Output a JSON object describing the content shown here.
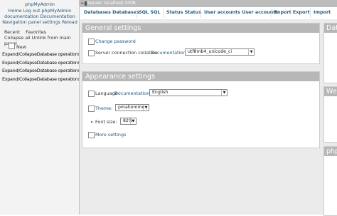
{
  "nav": {
    "logo": "phpMyAdmin",
    "links": "Home Log out phpMyAdmin documentation Documentation Navigation panel settings Reload navigation panel",
    "recent": "Recent",
    "favorites": "Favorites",
    "collapse": "Collapse all Unlink from main panel",
    "new": "New",
    "databases": [
      "Expand/CollapseDatabase operations information_schema",
      "Expand/CollapseDatabase operations mysql",
      "Expand/CollapseDatabase operations performance_schema",
      "Expand/CollapseDatabase operations sys"
    ]
  },
  "topbar": {
    "server": "Server: localhost:3306"
  },
  "menu": {
    "tabs": [
      {
        "label1": "Databases",
        "label2": "Databases"
      },
      {
        "label1": "SQL",
        "label2": "SQL"
      },
      {
        "label1": "Status",
        "label2": "Status"
      },
      {
        "label1": "User accounts",
        "label2": "User accounts"
      },
      {
        "label1": "Export",
        "label2": "Export"
      },
      {
        "label1": "Import",
        "label2": ""
      }
    ]
  },
  "general": {
    "title": "General settings",
    "change_password": "Change password",
    "collation_label": "Server connection collation",
    "collation_doc": "Documentation",
    "collation_value": "utf8mb4_unicode_ci"
  },
  "appearance": {
    "title": "Appearance settings",
    "language_label": "Language",
    "language_doc": "Documentation",
    "language_value": "English",
    "theme_label": "Theme:",
    "theme_value": "pmahomme",
    "fontsize_label": "Font size:",
    "fontsize_value": "82%",
    "more_settings": "More settings"
  },
  "right": {
    "titles": [
      "Data",
      "Wel",
      "php"
    ]
  }
}
